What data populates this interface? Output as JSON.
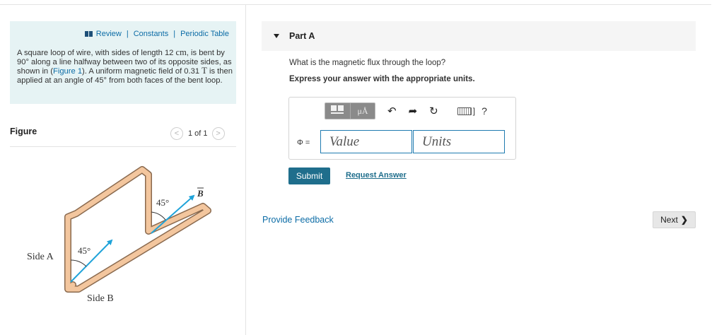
{
  "toolbar_links": {
    "review": "Review",
    "constants": "Constants",
    "periodic_table": "Periodic Table",
    "separator": "|"
  },
  "problem": {
    "t1": "A square loop of wire, with sides of length 12 ",
    "t2": "cm",
    "t3": ", is bent by 90° along a line halfway between two of its opposite sides, as shown in (",
    "fig_link": "Figure 1",
    "t4": "). A uniform magnetic field of 0.31 ",
    "t5": "T",
    "t6": " is then applied at an angle of 45° from both faces of the bent loop."
  },
  "figure": {
    "label": "Figure",
    "pager": "1 of 1",
    "prev": "<",
    "next": ">",
    "diagram": {
      "angle_top": "45°",
      "angle_left": "45°",
      "field": "B",
      "side_a": "Side A",
      "side_b": "Side B"
    }
  },
  "part": {
    "title": "Part A",
    "question": "What is the magnetic flux through the loop?",
    "instruction": "Express your answer with the appropriate units."
  },
  "answer": {
    "mu_label": "μÅ",
    "label": "Φ =",
    "value_placeholder": "Value",
    "units_placeholder": "Units",
    "help": "?",
    "bracket": "]"
  },
  "actions": {
    "submit": "Submit",
    "request_answer": "Request Answer",
    "feedback": "Provide Feedback",
    "next": "Next"
  },
  "icons": {
    "undo": "undo-arrow-icon",
    "redo": "redo-arrow-icon",
    "reset": "reset-icon",
    "keyboard": "keyboard-icon"
  },
  "colors": {
    "accent": "#0c6ca6",
    "submit_bg": "#1f6e8c",
    "panel_bg": "#e6f3f4",
    "arrow": "#1fa3d9",
    "loop": "#f3c69e"
  }
}
